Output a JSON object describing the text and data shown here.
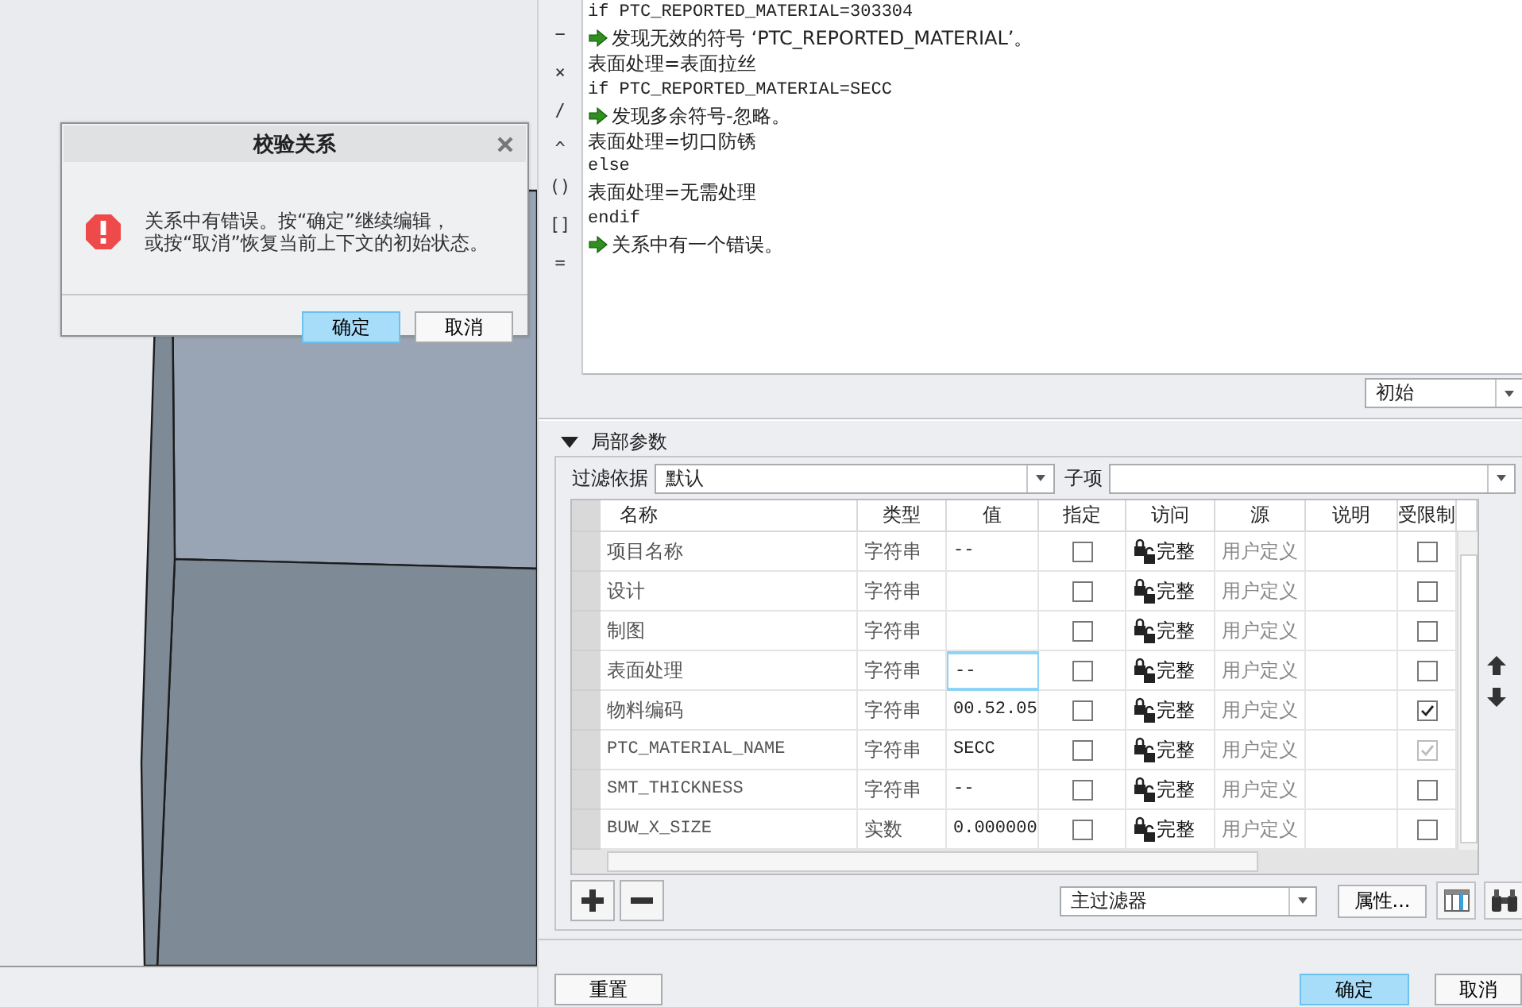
{
  "dialog": {
    "title": "校验关系",
    "message_lines": [
      "关系中有错误。按“确定”继续编辑，",
      "或按“取消”恢复当前上下文的初始状态。"
    ],
    "buttons": [
      {
        "label": "确定",
        "primary": true
      },
      {
        "label": "取消",
        "primary": false
      }
    ]
  },
  "relations_editor": {
    "toolbar_symbols": [
      "−",
      "×",
      "/",
      "^",
      "()",
      "[]",
      "="
    ],
    "lines": [
      {
        "kind": "code",
        "text": "if PTC_REPORTED_MATERIAL=303304"
      },
      {
        "kind": "message",
        "text": "发现无效的符号 ‘PTC_REPORTED_MATERIAL’。"
      },
      {
        "kind": "code",
        "text": "表面处理=表面拉丝"
      },
      {
        "kind": "code",
        "text": "if PTC_REPORTED_MATERIAL=SECC"
      },
      {
        "kind": "message",
        "text": "发现多余符号-忽略。"
      },
      {
        "kind": "code",
        "text": "表面处理=切口防锈"
      },
      {
        "kind": "code",
        "text": "else"
      },
      {
        "kind": "code",
        "text": "表面处理=无需处理"
      },
      {
        "kind": "code",
        "text": "endif"
      },
      {
        "kind": "message",
        "text": "关系中有一个错误。"
      }
    ]
  },
  "context_dropdown": {
    "value": "初始"
  },
  "local_parameters": {
    "title": "局部参数",
    "expanded": true,
    "filter_label": "过滤依据",
    "filter_value": "默认",
    "child_label": "子项",
    "table": {
      "columns": [
        "名称",
        "类型",
        "值",
        "指定",
        "访问",
        "源",
        "说明",
        "受限制"
      ],
      "rows": [
        {
          "name": "项目名称",
          "type": "字符串",
          "value": "--",
          "focused": false,
          "designated": false,
          "access": "完整",
          "source": "用户定义",
          "restricted": {
            "checked": false,
            "disabled": false
          }
        },
        {
          "name": "设计",
          "type": "字符串",
          "focused": false,
          "designated": false,
          "access": "完整",
          "source": "用户定义",
          "restricted": {
            "checked": false,
            "disabled": false
          }
        },
        {
          "name": "制图",
          "type": "字符串",
          "focused": false,
          "designated": false,
          "access": "完整",
          "source": "用户定义",
          "restricted": {
            "checked": false,
            "disabled": false
          }
        },
        {
          "name": "表面处理",
          "type": "字符串",
          "value": "--",
          "focused": true,
          "designated": false,
          "access": "完整",
          "source": "用户定义",
          "restricted": {
            "checked": false,
            "disabled": false
          }
        },
        {
          "name": "物料编码",
          "type": "字符串",
          "value": "00.52.05",
          "focused": false,
          "designated": false,
          "access": "完整",
          "source": "用户定义",
          "restricted": {
            "checked": true,
            "disabled": false
          }
        },
        {
          "name": "PTC_MATERIAL_NAME",
          "type": "字符串",
          "value": "SECC",
          "focused": false,
          "designated": false,
          "access": "完整",
          "source": "用户定义",
          "restricted": {
            "checked": true,
            "disabled": true
          }
        },
        {
          "name": "SMT_THICKNESS",
          "type": "字符串",
          "value": "--",
          "focused": false,
          "designated": false,
          "access": "完整",
          "source": "用户定义",
          "restricted": {
            "checked": false,
            "disabled": false
          }
        },
        {
          "name": "BUW_X_SIZE",
          "type": "实数",
          "value": "0.000000",
          "focused": false,
          "designated": false,
          "access": "完整",
          "source": "用户定义",
          "restricted": {
            "checked": false,
            "disabled": false
          }
        }
      ]
    },
    "filter_dropdown": {
      "value": "主过滤器"
    },
    "properties_button": "属性..."
  },
  "footer_buttons": [
    {
      "label": "重置",
      "primary": false
    },
    {
      "label": "确定",
      "primary": true
    },
    {
      "label": "取消",
      "primary": false
    }
  ]
}
